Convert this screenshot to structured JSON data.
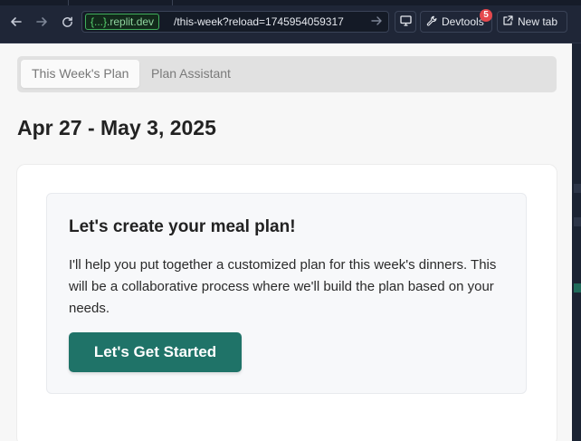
{
  "browser": {
    "url_host_prefix": "{...}",
    "url_host": ".replit.dev",
    "url_path": "/this-week?reload=1745954059317",
    "devtools_label": "Devtools",
    "devtools_badge": "5",
    "new_tab_label": "New tab"
  },
  "tabs": [
    {
      "label": "This Week's Plan",
      "active": true
    },
    {
      "label": "Plan Assistant",
      "active": false
    }
  ],
  "week_title": "Apr 27 - May 3, 2025",
  "card": {
    "title": "Let's create your meal plan!",
    "body": "I'll help you put together a customized plan for this week's dinners. This will be a collaborative process where we'll build the plan based on your needs.",
    "cta_label": "Let's Get Started"
  },
  "colors": {
    "accent": "#1f7368",
    "url_host": "#57d36f",
    "badge": "#e5484d"
  }
}
